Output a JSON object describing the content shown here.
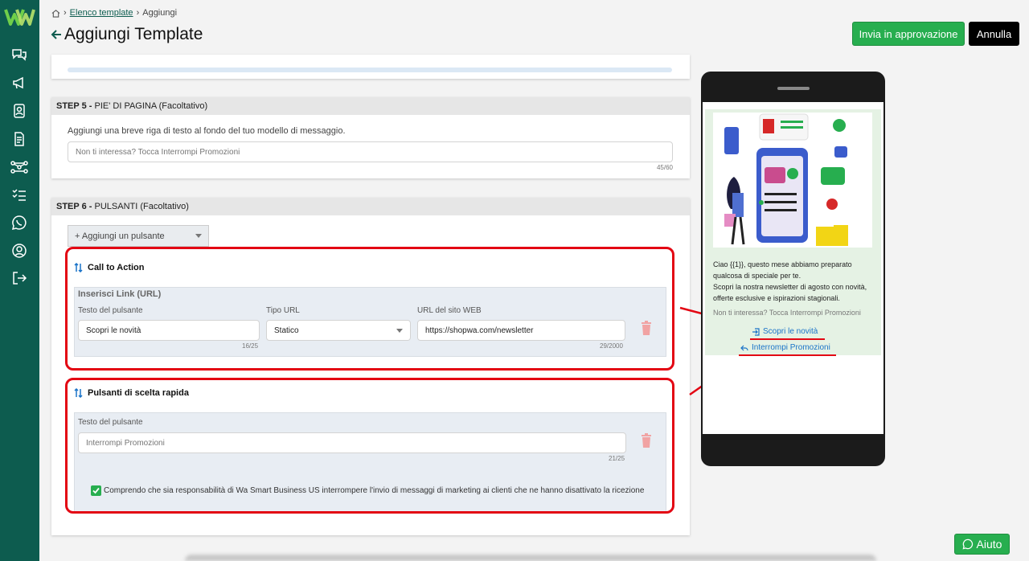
{
  "sidebar": {
    "items": [
      {
        "icon": "chat-icon"
      },
      {
        "icon": "megaphone-icon"
      },
      {
        "icon": "contacts-icon"
      },
      {
        "icon": "document-icon"
      },
      {
        "icon": "flow-icon"
      },
      {
        "icon": "checklist-icon"
      },
      {
        "icon": "whatsapp-icon"
      },
      {
        "icon": "user-icon"
      },
      {
        "icon": "logout-icon"
      }
    ]
  },
  "breadcrumb": {
    "home_icon": "home-icon",
    "link": "Elenco template",
    "current": "Aggiungi"
  },
  "header": {
    "title": "Aggiungi Template",
    "approve_label": "Invia in approvazione",
    "cancel_label": "Annulla"
  },
  "step5": {
    "step": "STEP 5 -",
    "title": "PIE' DI PAGINA (Facoltativo)",
    "hint": "Aggiungi una breve riga di testo al fondo del tuo modello di messaggio.",
    "placeholder": "Non ti interessa? Tocca Interrompi Promozioni",
    "counter": "45/60"
  },
  "step6": {
    "step": "STEP 6 -",
    "title": "PULSANTI (Facoltativo)",
    "add_button": "+ Aggiungi un pulsante",
    "cta": {
      "title": "Call to Action",
      "panel_title": "Inserisci Link (URL)",
      "text_label": "Testo del pulsante",
      "text_value": "Scopri le novità",
      "text_counter": "16/25",
      "type_label": "Tipo URL",
      "type_value": "Statico",
      "url_label": "URL del sito WEB",
      "url_value": "https://shopwa.com/newsletter",
      "url_counter": "29/2000"
    },
    "quick": {
      "title": "Pulsanti di scelta rapida",
      "text_label": "Testo del pulsante",
      "placeholder": "Interrompi Promozioni",
      "counter": "21/25",
      "consent": "Comprendo che sia responsabilità di Wa Smart Business US interrompere l'invio di messaggi di marketing ai clienti che ne hanno disattivato la ricezione",
      "consent_checked": true
    }
  },
  "preview": {
    "message": "Ciao {{1}}, questo mese abbiamo preparato qualcosa di speciale per te.\nScopri la nostra newsletter di agosto con novità, offerte esclusive e ispirazioni stagionali.",
    "footer": "Non ti interessa? Tocca Interrompi Promozioni",
    "cta_button": "Scopri le novità",
    "quick_button": "Interrompi Promozioni"
  },
  "help": {
    "label": "Aiuto"
  },
  "colors": {
    "sidebar": "#0d5c4f",
    "accent": "#27ae4f",
    "highlight": "#e30613",
    "link": "#1a73c8"
  }
}
